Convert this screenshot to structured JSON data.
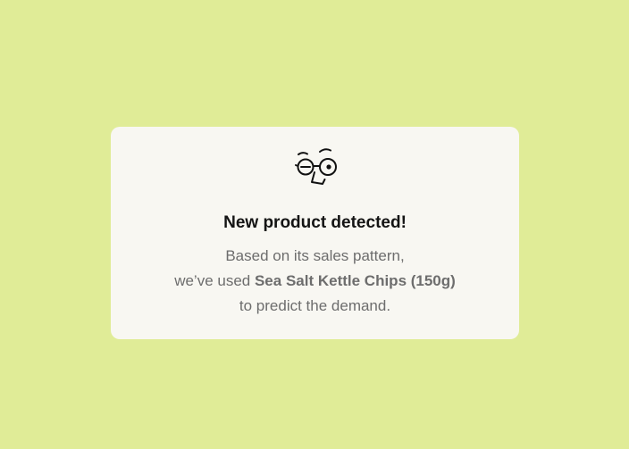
{
  "notice": {
    "icon": "nerd-face-glasses-icon",
    "title": "New product detected!",
    "line1": "Based on its sales pattern,",
    "line2_prefix": "we’ve used ",
    "product_name": "Sea Salt Kettle Chips (150g)",
    "line3": "to predict the demand."
  },
  "colors": {
    "background": "#e0ec97",
    "card": "#f8f7f2",
    "title": "#141414",
    "body_text": "#6d6d6d"
  }
}
